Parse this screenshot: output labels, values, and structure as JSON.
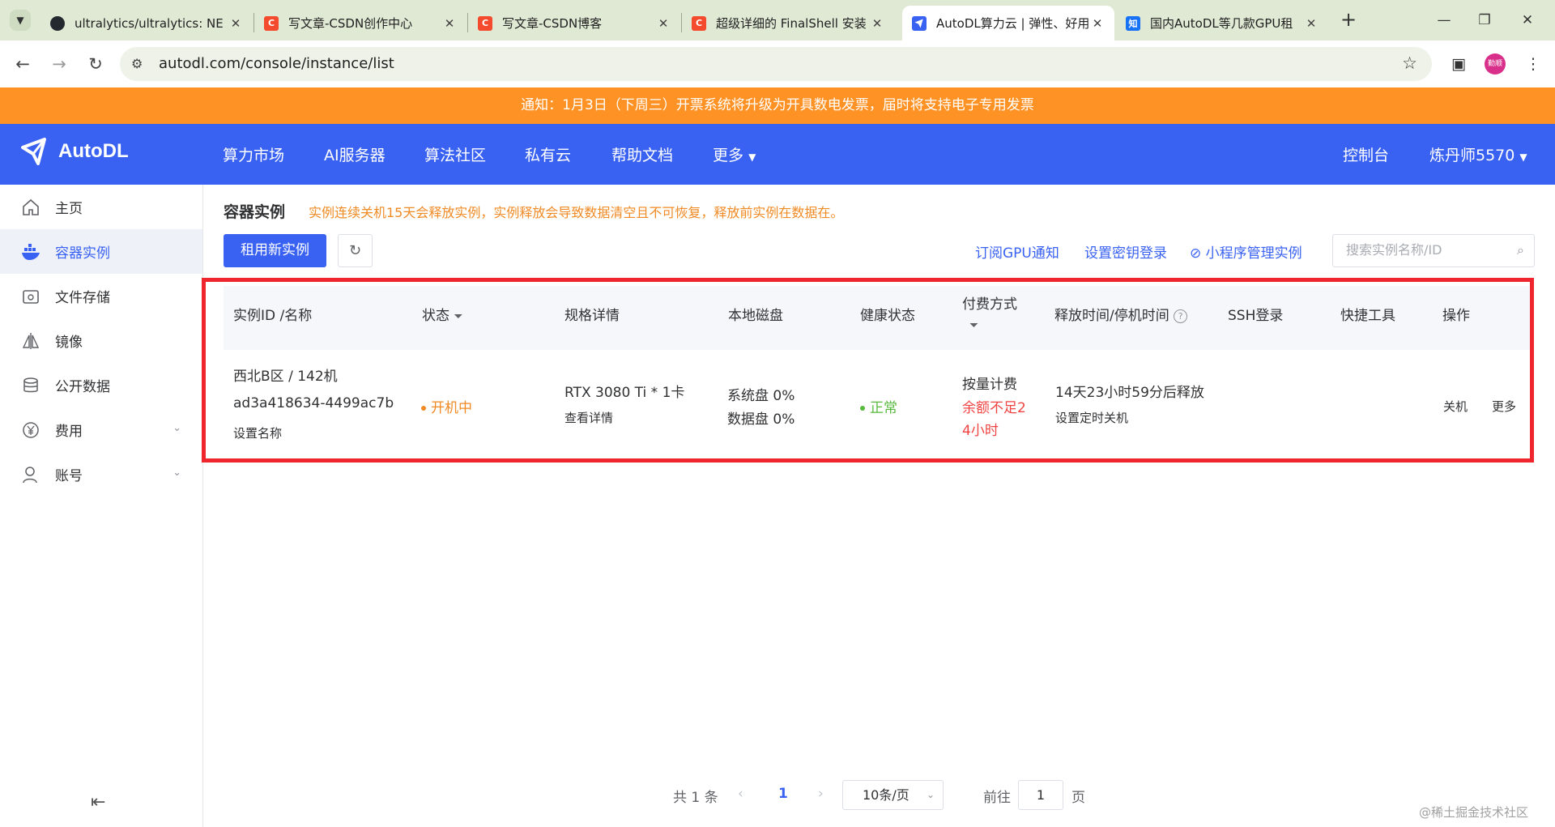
{
  "browser": {
    "tabs": [
      {
        "title": "ultralytics/ultralytics: NE",
        "icon": "github-icon",
        "close": "✕"
      },
      {
        "title": "写文章-CSDN创作中心",
        "icon": "csdn-icon",
        "close": "✕"
      },
      {
        "title": "写文章-CSDN博客",
        "icon": "csdn-icon",
        "close": "✕"
      },
      {
        "title": "超级详细的 FinalShell 安装",
        "icon": "csdn-icon",
        "close": "✕"
      },
      {
        "title": "AutoDL算力云 | 弹性、好用",
        "icon": "autodl-icon",
        "close": "✕"
      },
      {
        "title": "国内AutoDL等几款GPU租",
        "icon": "zhihu-icon",
        "close": "✕"
      }
    ],
    "zhihu_glyph": "知",
    "url": "autodl.com/console/instance/list",
    "profile_label": "勤顺"
  },
  "notice": "通知：1月3日（下周三）开票系统将升级为开具数电发票，届时将支持电子专用发票",
  "header": {
    "logo": "AutoDL",
    "nav": [
      "算力市场",
      "AI服务器",
      "算法社区",
      "私有云",
      "帮助文档",
      "更多"
    ],
    "console": "控制台",
    "user": "炼丹师5570"
  },
  "sidebar": {
    "items": [
      {
        "label": "主页",
        "icon": "home-icon"
      },
      {
        "label": "容器实例",
        "icon": "container-icon"
      },
      {
        "label": "文件存储",
        "icon": "storage-icon"
      },
      {
        "label": "镜像",
        "icon": "image-icon"
      },
      {
        "label": "公开数据",
        "icon": "database-icon"
      },
      {
        "label": "费用",
        "icon": "yen-icon"
      },
      {
        "label": "账号",
        "icon": "user-icon"
      }
    ]
  },
  "main": {
    "title": "容器实例",
    "warning": "实例连续关机15天会释放实例，实例释放会导致数据清空且不可恢复，释放前实例在数据在。",
    "new_instance_button": "租用新实例",
    "links": [
      "订阅GPU通知",
      "设置密钥登录",
      "小程序管理实例"
    ],
    "search_placeholder": "搜索实例名称/ID"
  },
  "table": {
    "headers": [
      "实例ID /名称",
      "状态",
      "规格详情",
      "本地磁盘",
      "健康状态",
      "付费方式",
      "释放时间/停机时间",
      "SSH登录",
      "快捷工具",
      "操作"
    ],
    "row": {
      "name": "西北B区 / 142机",
      "id": "ad3a418634-4499ac7b",
      "set_name": "设置名称",
      "status": "开机中",
      "spec": "RTX 3080 Ti * 1卡",
      "spec_link": "查看详情",
      "disk_system": "系统盘 0%",
      "disk_data": "数据盘 0%",
      "health": "正常",
      "billing": "按量计费",
      "balance_warn_1": "余额不足2",
      "balance_warn_2": "4小时",
      "release": "14天23小时59分后释放",
      "release_link": "设置定时关机",
      "op_shutdown": "关机",
      "op_more": "更多"
    }
  },
  "pagination": {
    "total": "共 1 条",
    "current_page": "1",
    "page_size": "10条/页",
    "goto_prefix": "前往",
    "goto_value": "1",
    "goto_suffix": "页"
  },
  "watermark": "@稀土掘金技术社区",
  "colors": {
    "brand": "#3a62f2",
    "notice": "#ff9224",
    "highlight_box": "#f0262f",
    "running": "#f08a24",
    "healthy": "#59b83d",
    "danger": "#f04444"
  }
}
